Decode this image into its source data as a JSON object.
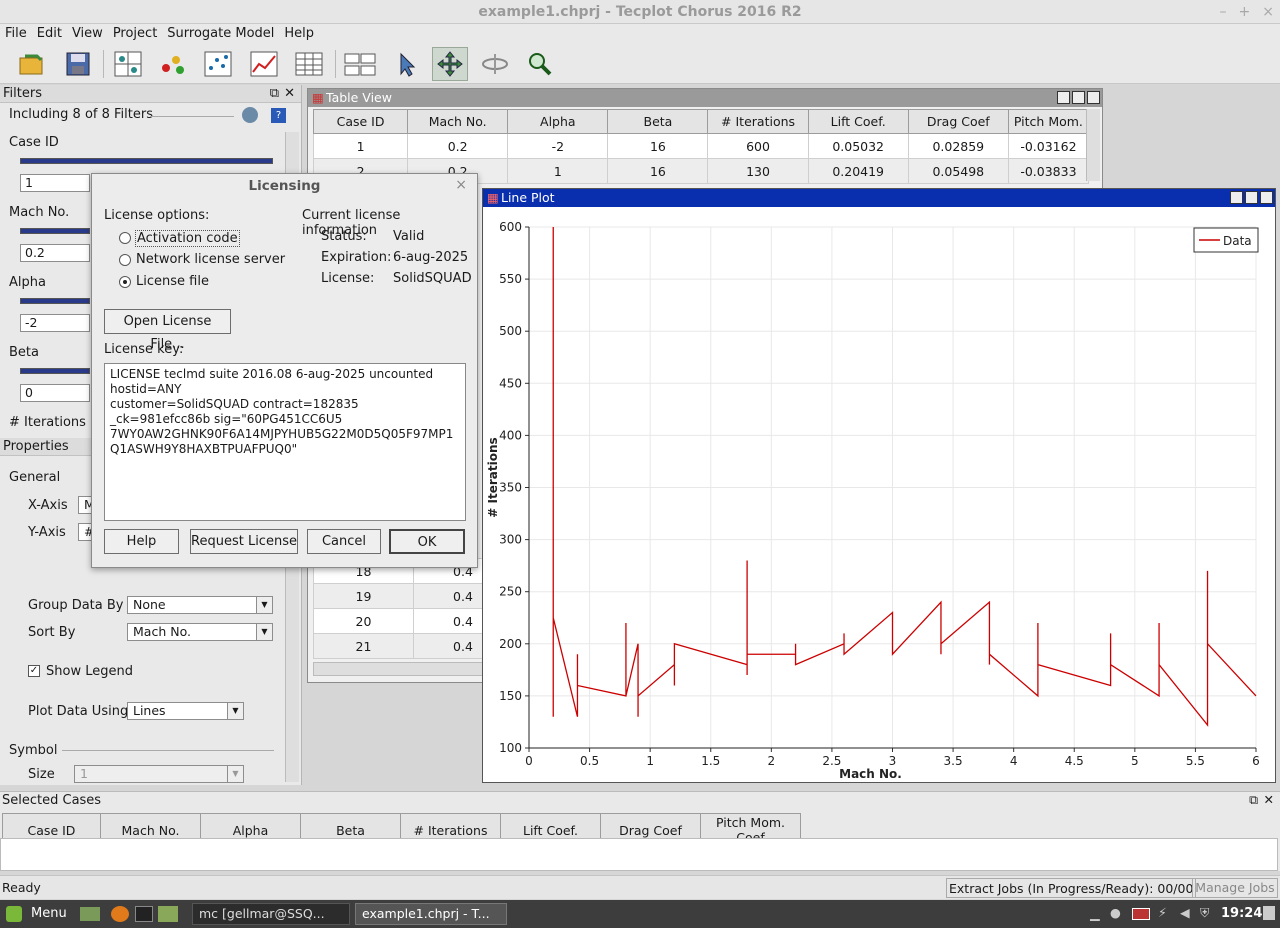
{
  "window": {
    "title": "example1.chprj - Tecplot Chorus 2016 R2"
  },
  "menu": [
    "File",
    "Edit",
    "View",
    "Project",
    "Surrogate Model",
    "Help"
  ],
  "filters": {
    "header": "Filters",
    "summary": "Including 8 of 8 Filters",
    "items": [
      {
        "label": "Case ID",
        "value": "1"
      },
      {
        "label": "Mach No.",
        "value": "0.2"
      },
      {
        "label": "Alpha",
        "value": "-2"
      },
      {
        "label": "Beta",
        "value": "0"
      },
      {
        "label": "# Iterations",
        "value": ""
      }
    ]
  },
  "properties": {
    "header": "Properties",
    "general": "General",
    "xaxis_label": "X-Axis",
    "xaxis_value": "M",
    "yaxis_label": "Y-Axis",
    "yaxis_value": "#",
    "group_label": "Group Data By",
    "group_value": "None",
    "sort_label": "Sort By",
    "sort_value": "Mach No.",
    "show_legend": "Show Legend",
    "plot_using_label": "Plot Data Using",
    "plot_using_value": "Lines",
    "symbol": "Symbol",
    "size_label": "Size",
    "size_value": "1"
  },
  "table": {
    "title": "Table View",
    "columns": [
      "Case ID",
      "Mach No.",
      "Alpha",
      "Beta",
      "# Iterations",
      "Lift Coef.",
      "Drag Coef",
      "Pitch Mom."
    ],
    "rows": [
      [
        "1",
        "0.2",
        "-2",
        "16",
        "600",
        "0.05032",
        "0.02859",
        "-0.03162"
      ],
      [
        "2",
        "0.2",
        "1",
        "16",
        "130",
        "0.20419",
        "0.05498",
        "-0.03833"
      ]
    ],
    "lower_rows": [
      [
        "18",
        "0.4"
      ],
      [
        "19",
        "0.4"
      ],
      [
        "20",
        "0.4"
      ],
      [
        "21",
        "0.4"
      ]
    ]
  },
  "plot": {
    "title": "Line Plot",
    "legend": "Data",
    "series_color": "#cc0000"
  },
  "chart_data": {
    "type": "line",
    "xlabel": "Mach No.",
    "ylabel": "# Iterations",
    "xlim": [
      0,
      6
    ],
    "ylim": [
      100,
      600
    ],
    "xticks": [
      "0",
      "0.5",
      "1",
      "1.5",
      "2",
      "2.5",
      "3",
      "3.5",
      "4",
      "4.5",
      "5",
      "5.5",
      "6"
    ],
    "yticks": [
      "100",
      "150",
      "200",
      "250",
      "300",
      "350",
      "400",
      "450",
      "500",
      "550",
      "600"
    ],
    "grid": true,
    "legend_position": "top-right",
    "series": [
      {
        "name": "Data",
        "x": [
          0.2,
          0.2,
          0.2,
          0.2,
          0.4,
          0.4,
          0.4,
          0.4,
          0.8,
          0.8,
          0.8,
          0.9,
          0.9,
          0.9,
          0.9,
          1.2,
          1.2,
          1.2,
          1.8,
          1.8,
          1.8,
          1.8,
          2.2,
          2.2,
          2.2,
          2.6,
          2.6,
          2.6,
          3.0,
          3.0,
          3.4,
          3.4,
          3.4,
          3.8,
          3.8,
          3.8,
          4.2,
          4.2,
          4.2,
          4.8,
          4.8,
          4.8,
          5.2,
          5.2,
          5.2,
          5.6,
          5.6,
          5.6,
          6.0
        ],
        "y": [
          130,
          600,
          240,
          225,
          130,
          190,
          160,
          160,
          150,
          220,
          150,
          200,
          130,
          150,
          150,
          180,
          160,
          200,
          180,
          170,
          280,
          190,
          190,
          200,
          180,
          200,
          210,
          190,
          230,
          190,
          240,
          190,
          200,
          240,
          180,
          190,
          150,
          220,
          180,
          160,
          210,
          180,
          150,
          220,
          180,
          122,
          270,
          200,
          150
        ]
      }
    ]
  },
  "dialog": {
    "title": "Licensing",
    "options_label": "License options:",
    "options": [
      "Activation code",
      "Network license server",
      "License file"
    ],
    "selected_option": 2,
    "info_header": "Current license information",
    "status_label": "Status:",
    "status_value": "Valid",
    "expiration_label": "Expiration:",
    "expiration_value": "6-aug-2025",
    "license_label": "License:",
    "license_value": "SolidSQUAD",
    "open_button": "Open License File...",
    "key_label": "License key:",
    "key_text": "LICENSE teclmd suite 2016.08 6-aug-2025 uncounted\nhostid=ANY\ncustomer=SolidSQUAD contract=182835\n_ck=981efcc86b sig=\"60PG451CC6U5\n7WY0AW2GHNK90F6A14MJPYHUB5G22M0D5Q05F97MP1\nQ1ASWH9Y8HAXBTPUAFPUQ0\"",
    "buttons": [
      "Help",
      "Request License",
      "Cancel",
      "OK"
    ]
  },
  "selected_cases": {
    "header": "Selected Cases",
    "columns": [
      "Case ID",
      "Mach No.",
      "Alpha",
      "Beta",
      "# Iterations",
      "Lift Coef.",
      "Drag Coef",
      "Pitch Mom. Coef"
    ]
  },
  "status": {
    "left": "Ready",
    "jobs": "Extract Jobs (In Progress/Ready): 00/00",
    "manage": "Manage Jobs"
  },
  "taskbar": {
    "menu": "Menu",
    "task1": "mc [gellmar@SSQ...",
    "task2": "example1.chprj - T...",
    "clock": "19:24"
  }
}
